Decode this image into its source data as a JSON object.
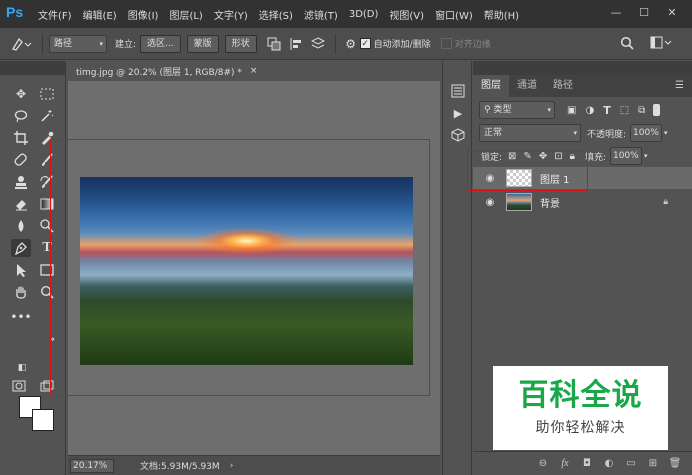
{
  "app": {
    "logo": "Ps"
  },
  "menu": [
    "文件(F)",
    "编辑(E)",
    "图像(I)",
    "图层(L)",
    "文字(Y)",
    "选择(S)",
    "滤镜(T)",
    "3D(D)",
    "视图(V)",
    "窗口(W)",
    "帮助(H)"
  ],
  "window_controls": {
    "minimize": "—",
    "maximize": "☐",
    "close": "✕"
  },
  "options": {
    "path_mode": "路径",
    "build_label": "建立:",
    "selection_btn": "选区...",
    "mask_btn": "蒙版",
    "shape_btn": "形状",
    "auto_add_delete": "自动添加/删除",
    "auto_add_checked": true,
    "align_edges": "对齐边缘",
    "align_edges_checked": false
  },
  "document": {
    "tab_title": "timg.jpg @ 20.2% (图层 1, RGB/8#) *",
    "close": "×",
    "zoom": "20.17%",
    "doc_info": "文档:5.93M/5.93M"
  },
  "layers_panel": {
    "tabs": [
      "图层",
      "通道",
      "路径"
    ],
    "active_tab": "图层",
    "filter_kind": "类型",
    "blend_mode": "正常",
    "opacity_label": "不透明度:",
    "opacity": "100%",
    "lock_label": "锁定:",
    "fill_label": "填充:",
    "fill": "100%",
    "layers": [
      {
        "name": "图层 1",
        "selected": true,
        "thumb": "transparent",
        "locked": false
      },
      {
        "name": "背景",
        "selected": false,
        "thumb": "photo",
        "locked": true
      }
    ]
  },
  "watermark": {
    "title": "百科全说",
    "subtitle": "助你轻松解决"
  },
  "colors": {
    "accent": "#31a8ff",
    "highlight_box": "#dd1111",
    "watermark_green": "#18a84a"
  }
}
